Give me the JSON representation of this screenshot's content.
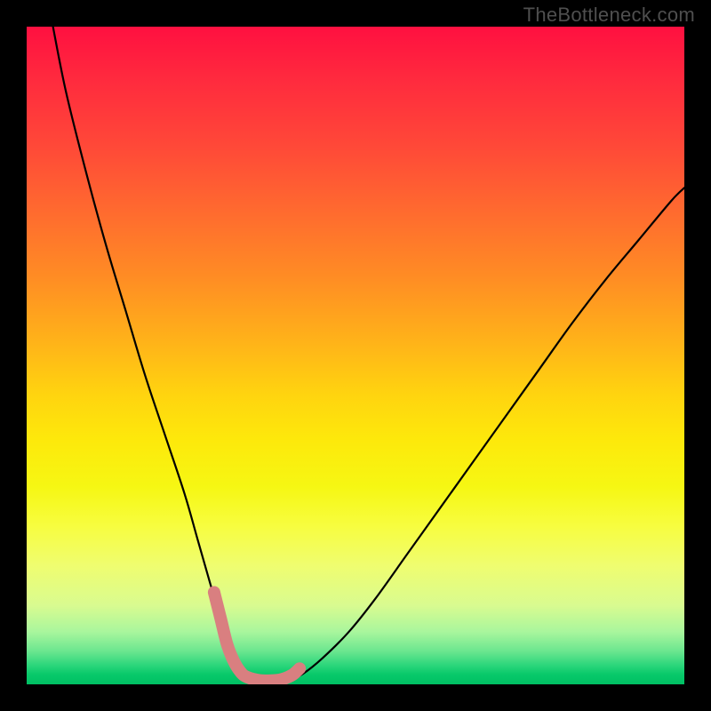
{
  "watermark": "TheBottleneck.com",
  "chart_data": {
    "type": "line",
    "title": "",
    "xlabel": "",
    "ylabel": "",
    "xlim": [
      0,
      100
    ],
    "ylim": [
      0,
      100
    ],
    "series": [
      {
        "name": "main-curve",
        "color": "#000000",
        "x": [
          4,
          6,
          9,
          12,
          15,
          18,
          21,
          24,
          26,
          28,
          29.5,
          30.5,
          31.5,
          33,
          35,
          37,
          38.5,
          40,
          42,
          45,
          49,
          53,
          58,
          63,
          68,
          73,
          78,
          83,
          88,
          93,
          98,
          100
        ],
        "values": [
          100,
          90,
          78,
          67,
          57,
          47,
          38,
          29,
          22,
          15,
          10,
          6,
          3.5,
          1.8,
          0.8,
          0.5,
          0.5,
          0.7,
          1.6,
          4,
          8,
          13,
          20,
          27,
          34,
          41,
          48,
          55,
          61.5,
          67.5,
          73.5,
          75.5
        ]
      },
      {
        "name": "pink-overlay",
        "color": "#d97f80",
        "x": [
          28.5,
          29.5,
          30.5,
          31.5,
          32.5,
          33.5,
          35.5,
          37.5,
          38.5,
          39.5,
          40.5,
          41.5
        ],
        "values": [
          14,
          10,
          6,
          3.5,
          1.9,
          1.1,
          0.6,
          0.6,
          0.7,
          1.0,
          1.5,
          2.4
        ]
      }
    ]
  }
}
